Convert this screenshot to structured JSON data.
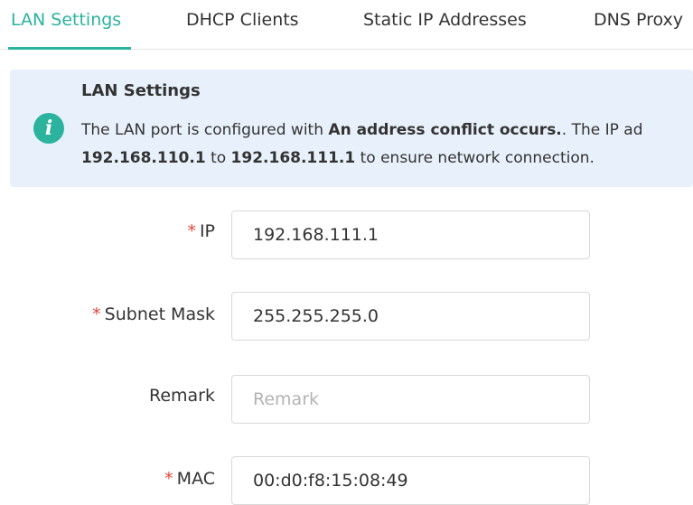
{
  "tabs": [
    {
      "label": "LAN Settings",
      "active": true
    },
    {
      "label": "DHCP Clients",
      "active": false
    },
    {
      "label": "Static IP Addresses",
      "active": false
    },
    {
      "label": "DNS Proxy",
      "active": false
    }
  ],
  "notice": {
    "icon": "info-icon",
    "icon_glyph": "i",
    "title": "LAN Settings",
    "line1_prefix": "The LAN port is configured with ",
    "line1_bold": "An address conflict occurs.",
    "line1_suffix": ". The IP ad",
    "line2_from": "192.168.110.1",
    "line2_mid": " to ",
    "line2_to": "192.168.111.1",
    "line2_suffix": " to ensure network connection."
  },
  "form": {
    "required_mark": "*",
    "ip": {
      "label": "IP",
      "value": "192.168.111.1"
    },
    "subnet_mask": {
      "label": "Subnet Mask",
      "value": "255.255.255.0"
    },
    "remark": {
      "label": "Remark",
      "value": "",
      "placeholder": "Remark"
    },
    "mac": {
      "label": "MAC",
      "value": "00:d0:f8:15:08:49"
    }
  },
  "colors": {
    "accent": "#2bb39e",
    "notice_bg": "#e8f1fb",
    "required": "#e0453a"
  }
}
